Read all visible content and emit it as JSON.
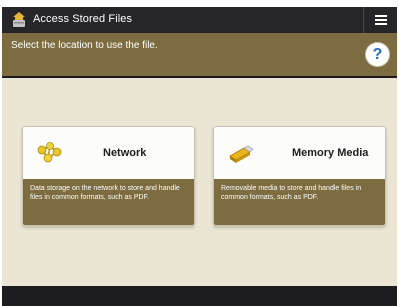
{
  "window": {
    "title": "Access Stored Files",
    "icon": "folder-app-icon",
    "menu_icon": "hamburger-menu-icon"
  },
  "instruction": {
    "text": "Select the location to use the file.",
    "help_label": "?"
  },
  "cards": [
    {
      "label": "Network",
      "icon": "network-icon",
      "description": "Data storage on the network to store and handle files in common formats, such as PDF."
    },
    {
      "label": "Memory Media",
      "icon": "memory-media-icon",
      "description": "Removable media to store and handle files in common formats, such as PDF."
    }
  ],
  "colors": {
    "titlebar": "#26262a",
    "accent": "#7c6c3f",
    "background": "#ebe5d3",
    "help": "#2a6ab8"
  }
}
